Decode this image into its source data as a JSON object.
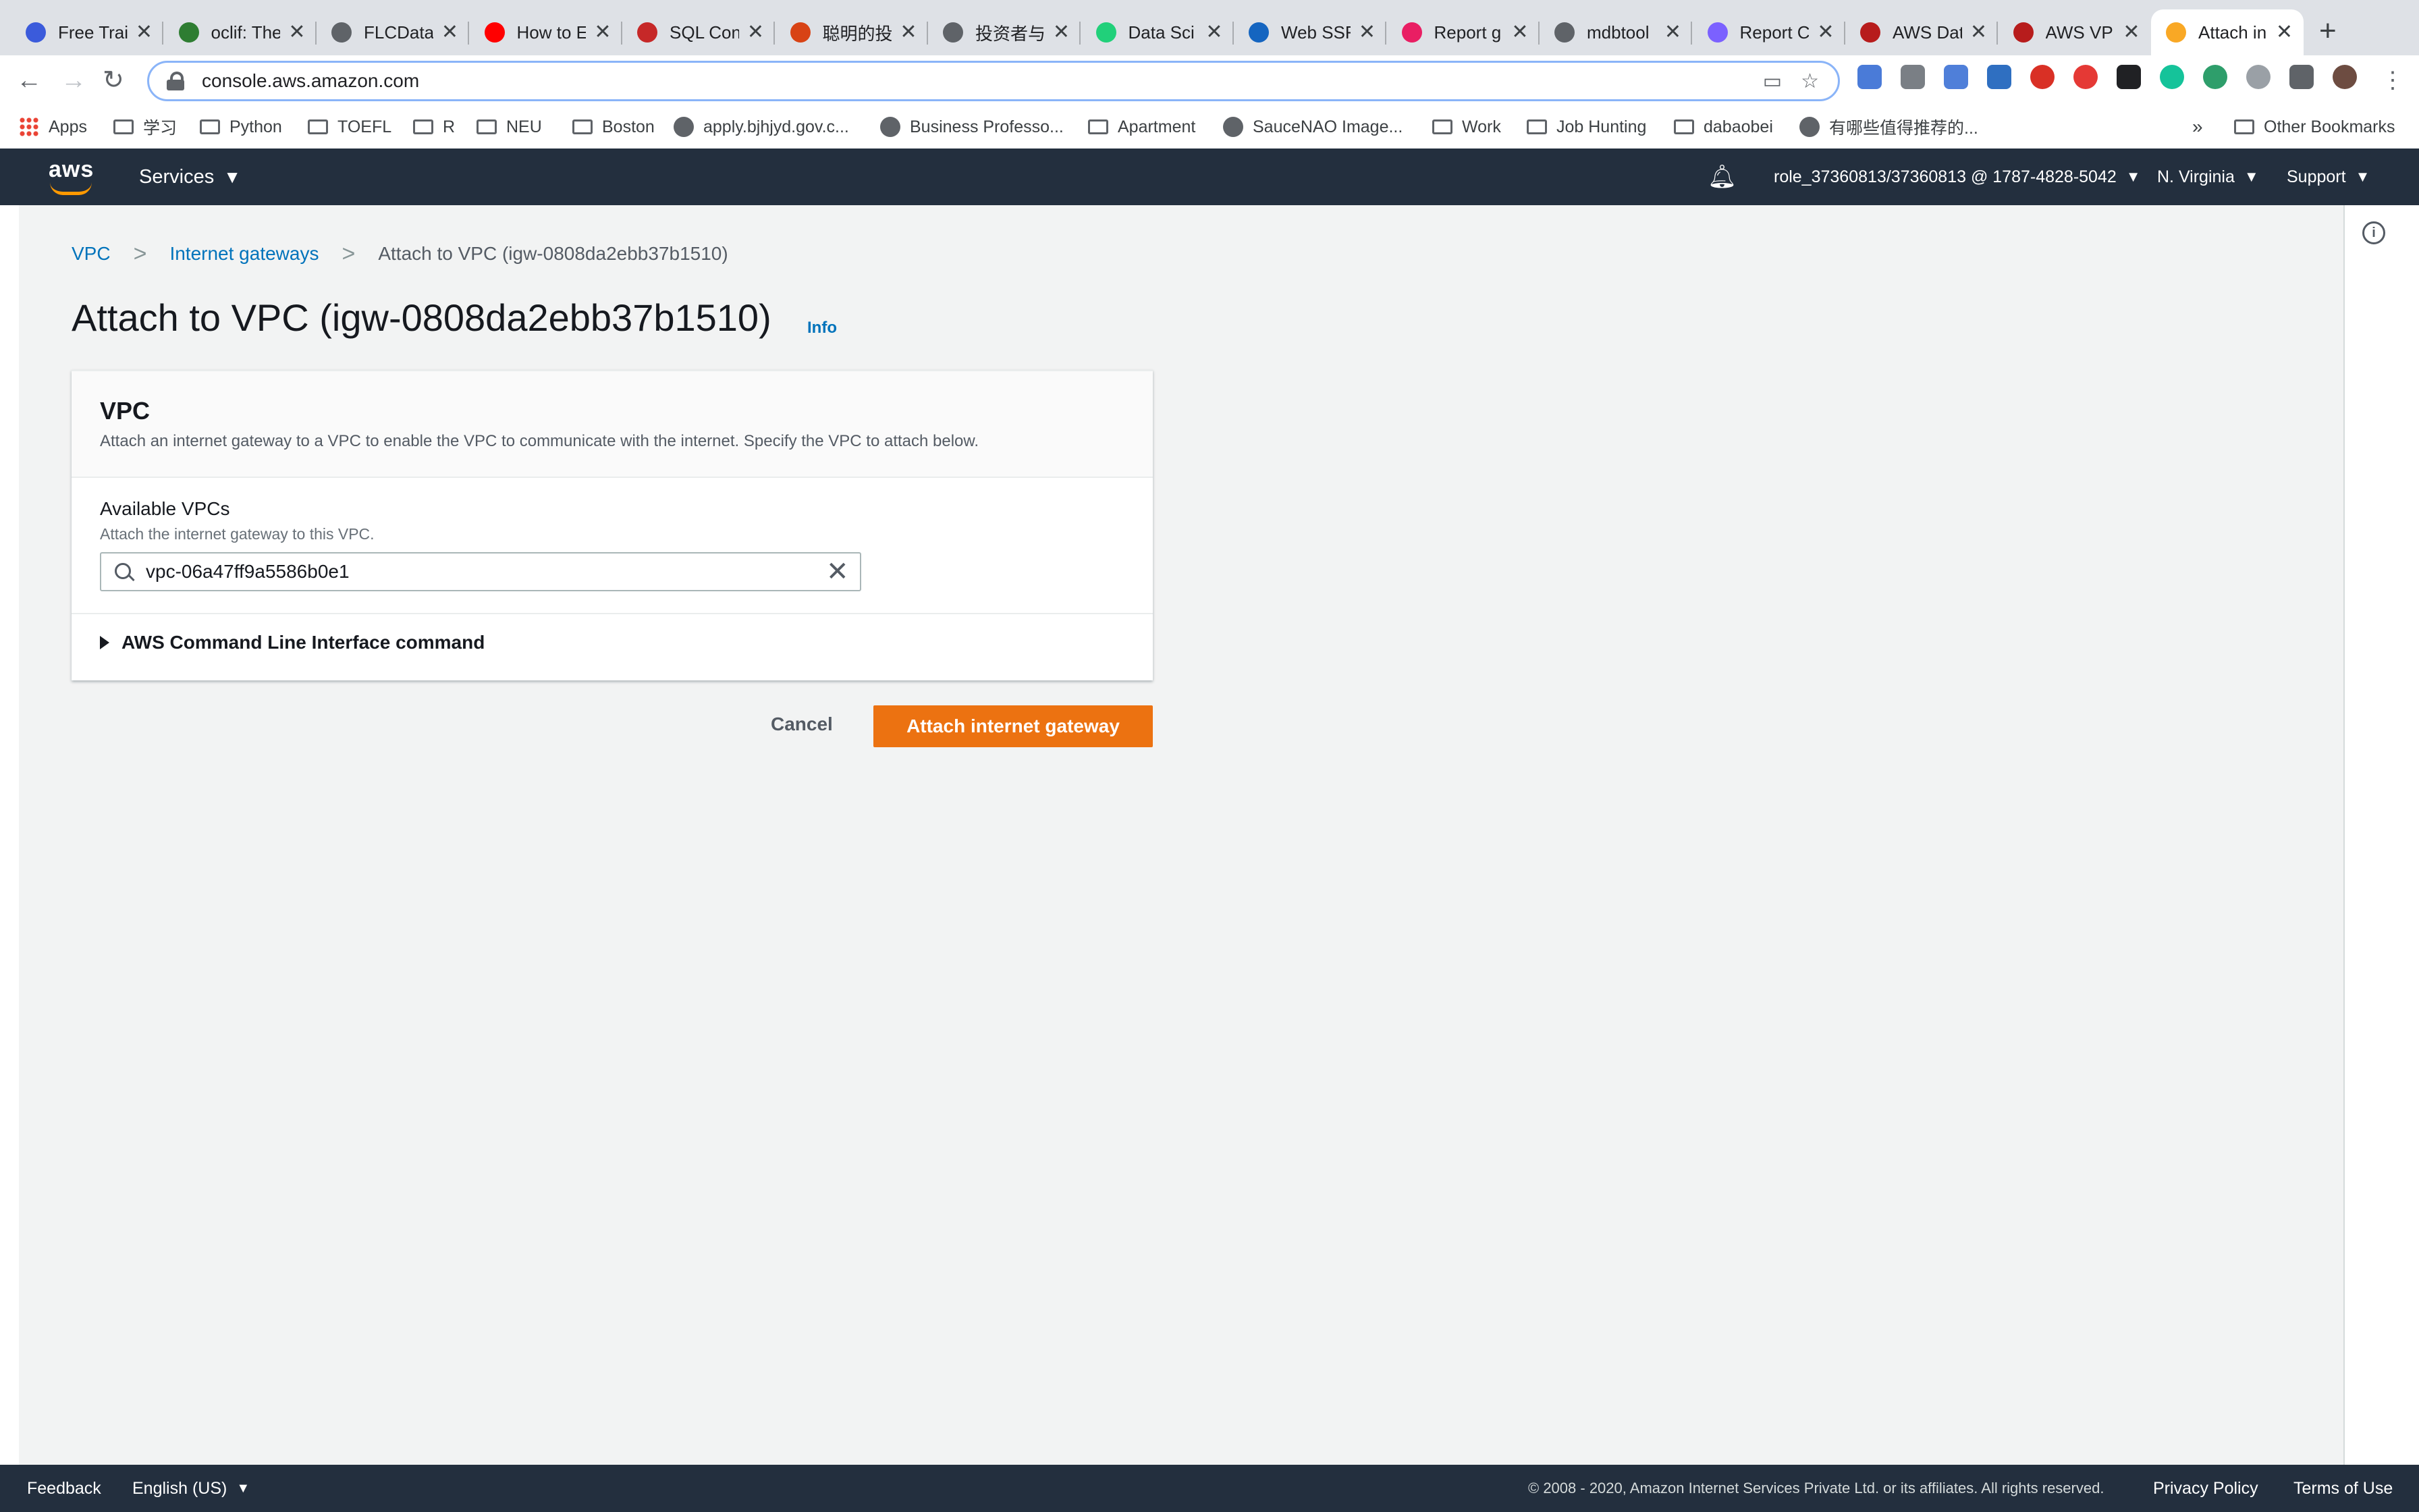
{
  "browser": {
    "tabs": [
      {
        "label": "Free Trai",
        "color": "#3b5bdb"
      },
      {
        "label": "oclif: The",
        "color": "#2e7d32"
      },
      {
        "label": "FLCData",
        "color": "#5f6368"
      },
      {
        "label": "How to E",
        "color": "#ff0000"
      },
      {
        "label": "SQL Con",
        "color": "#c62828"
      },
      {
        "label": "聪明的投",
        "color": "#d84315"
      },
      {
        "label": "投资者与",
        "color": "#5f6368"
      },
      {
        "label": "Data Sci",
        "color": "#21d07a"
      },
      {
        "label": "Web SSF",
        "color": "#1565c0"
      },
      {
        "label": "Report g",
        "color": "#e91e63"
      },
      {
        "label": "mdbtool",
        "color": "#5f6368"
      },
      {
        "label": "Report C",
        "color": "#7b61ff"
      },
      {
        "label": "AWS Dat",
        "color": "#b71c1c"
      },
      {
        "label": "AWS VP",
        "color": "#b71c1c"
      },
      {
        "label": "Attach in",
        "color": "#f9a825"
      }
    ],
    "close_glyph": "✕",
    "new_tab_glyph": "+",
    "url": "console.aws.amazon.com",
    "bookmarks": [
      {
        "label": "Apps",
        "type": "apps"
      },
      {
        "label": "学习",
        "type": "folder"
      },
      {
        "label": "Python",
        "type": "folder"
      },
      {
        "label": "TOEFL",
        "type": "folder"
      },
      {
        "label": "R",
        "type": "folder"
      },
      {
        "label": "NEU",
        "type": "folder"
      },
      {
        "label": "Boston",
        "type": "folder"
      },
      {
        "label": "apply.bjhjyd.gov.c...",
        "type": "site"
      },
      {
        "label": "Business Professo...",
        "type": "site"
      },
      {
        "label": "Apartment",
        "type": "folder"
      },
      {
        "label": "SauceNAO Image...",
        "type": "site"
      },
      {
        "label": "Work",
        "type": "folder"
      },
      {
        "label": "Job Hunting",
        "type": "folder"
      },
      {
        "label": "dabaobei",
        "type": "folder"
      },
      {
        "label": "有哪些值得推荐的...",
        "type": "site"
      }
    ],
    "bookmarks_overflow": "»",
    "other_bookmarks": "Other Bookmarks"
  },
  "aws_header": {
    "logo_text": "aws",
    "services_label": "Services",
    "account_label": "role_37360813/37360813 @ 1787-4828-5042",
    "region_label": "N. Virginia",
    "support_label": "Support",
    "accent_color": "#ff9900"
  },
  "breadcrumb": {
    "items": [
      "VPC",
      "Internet gateways"
    ],
    "current": "Attach to VPC (igw-0808da2ebb37b1510)"
  },
  "page": {
    "title": "Attach to VPC (igw-0808da2ebb37b1510)",
    "info_link": "Info"
  },
  "panel": {
    "title": "VPC",
    "description": "Attach an internet gateway to a VPC to enable the VPC to communicate with the internet. Specify the VPC to attach below.",
    "field_label": "Available VPCs",
    "field_description": "Attach the internet gateway to this VPC.",
    "field_value": "vpc-06a47ff9a5586b0e1",
    "cli_label": "AWS Command Line Interface command"
  },
  "actions": {
    "cancel_label": "Cancel",
    "primary_label": "Attach internet gateway",
    "primary_color": "#ec7211"
  },
  "footer": {
    "feedback_label": "Feedback",
    "language_label": "English (US)",
    "copyright": "© 2008 - 2020, Amazon Internet Services Private Ltd. or its affiliates. All rights reserved.",
    "privacy_label": "Privacy Policy",
    "terms_label": "Terms of Use"
  }
}
